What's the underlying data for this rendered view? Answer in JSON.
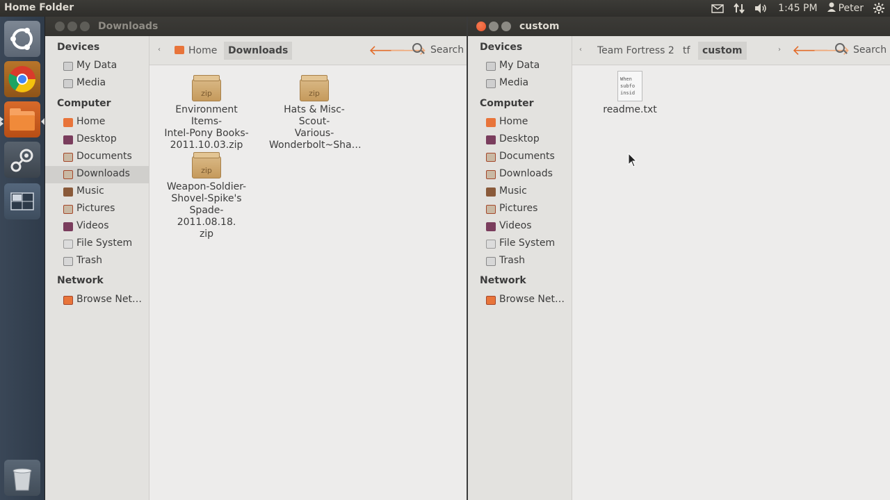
{
  "top_panel": {
    "app_title": "Home Folder",
    "time": "1:45 PM",
    "user": "Peter"
  },
  "launcher": {
    "items": [
      "ubuntu-dash",
      "chrome",
      "files",
      "steam",
      "workspaces",
      "trash"
    ]
  },
  "left_window": {
    "title": "Downloads",
    "sidebar": {
      "devices_header": "Devices",
      "devices": [
        "My Data",
        "Media"
      ],
      "computer_header": "Computer",
      "computer": [
        "Home",
        "Desktop",
        "Documents",
        "Downloads",
        "Music",
        "Pictures",
        "Videos",
        "File System",
        "Trash"
      ],
      "network_header": "Network",
      "network": [
        "Browse Net…"
      ]
    },
    "breadcrumbs": [
      "Home",
      "Downloads"
    ],
    "search_label": "Search",
    "files": [
      "Environment Items-Intel-Pony Books-2011.10.03.zip",
      "Hats & Misc-Scout-Various-Wonderbolt~Sha…",
      "Weapon-Soldier-Shovel-Spike's Spade-2011.08.18.zip"
    ],
    "file_lines": [
      [
        "Environment Items-",
        "Intel-Pony Books-",
        "2011.10.03.zip"
      ],
      [
        "Hats & Misc-Scout-",
        "Various-",
        "Wonderbolt~Sha…"
      ],
      [
        "Weapon-Soldier-",
        "Shovel-Spike's",
        "Spade-2011.08.18.",
        "zip"
      ]
    ],
    "zip_tag": "zip"
  },
  "right_window": {
    "title": "custom",
    "sidebar": {
      "devices_header": "Devices",
      "devices": [
        "My Data",
        "Media"
      ],
      "computer_header": "Computer",
      "computer": [
        "Home",
        "Desktop",
        "Documents",
        "Downloads",
        "Music",
        "Pictures",
        "Videos",
        "File System",
        "Trash"
      ],
      "network_header": "Network",
      "network": [
        "Browse Net…"
      ]
    },
    "breadcrumbs": [
      "Team Fortress 2",
      "tf",
      "custom"
    ],
    "search_label": "Search",
    "files": [
      "readme.txt"
    ],
    "txt_preview": [
      "When",
      "subfo",
      "insid"
    ]
  },
  "colors": {
    "accent_orange": "#e36c2a",
    "panel_dark": "#3c3b37",
    "close_button": "#e9542b"
  }
}
